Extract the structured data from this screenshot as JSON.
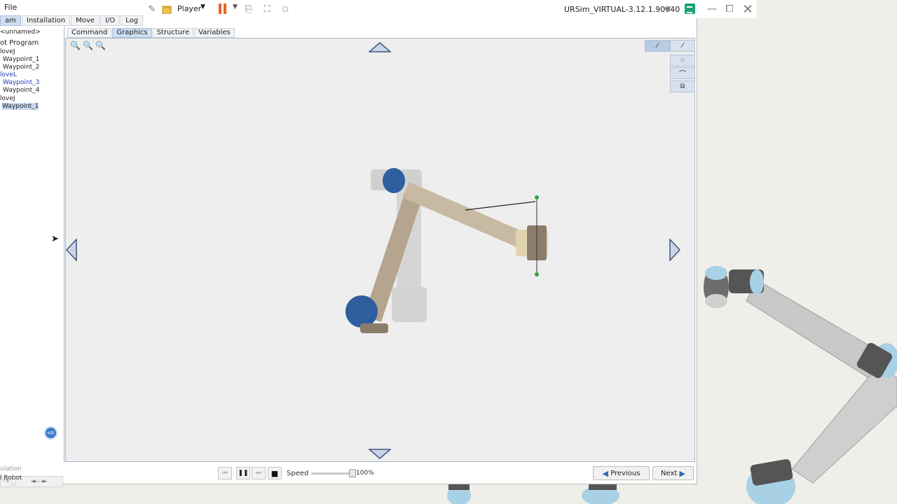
{
  "titlebar": {
    "file_menu": "File",
    "player_label": "Player",
    "window_title": "URSim_VIRTUAL-3.12.1.90940"
  },
  "main_tabs": [
    {
      "label": "am",
      "active": true
    },
    {
      "label": "Installation",
      "active": false
    },
    {
      "label": "Move",
      "active": false
    },
    {
      "label": "I/O",
      "active": false
    },
    {
      "label": "Log",
      "active": false
    }
  ],
  "program_tree": {
    "file_name": "unnamed>",
    "root": "ot Program",
    "items": [
      {
        "label": "loveJ",
        "type": "movej"
      },
      {
        "label": "Waypoint_1",
        "type": "waypoint"
      },
      {
        "label": "Waypoint_2",
        "type": "waypoint"
      },
      {
        "label": "loveL",
        "type": "movel"
      },
      {
        "label": "Waypoint_3",
        "type": "waypoint-blue"
      },
      {
        "label": "Waypoint_4",
        "type": "waypoint"
      },
      {
        "label": "loveJ",
        "type": "movej"
      },
      {
        "label": "Waypoint_1",
        "type": "selected"
      }
    ],
    "nav_arrows": "◄---►",
    "sim_label": "ulation",
    "robot_label": "l Robot"
  },
  "sub_tabs": [
    {
      "label": "Command",
      "active": false
    },
    {
      "label": "Graphics",
      "active": true
    },
    {
      "label": "Structure",
      "active": false
    },
    {
      "label": "Variables",
      "active": false
    }
  ],
  "bottom": {
    "speed_label": "Speed",
    "speed_value": "100%",
    "speed_fraction": 1.0,
    "previous_label": "Previous",
    "next_label": "Next"
  },
  "colors": {
    "pause_orange": "#e96423",
    "joint_blue": "#2f5e9f",
    "arm_tan": "#b5a58e",
    "tab_active": "#cfdff1",
    "notes_green": "#18a56e"
  }
}
